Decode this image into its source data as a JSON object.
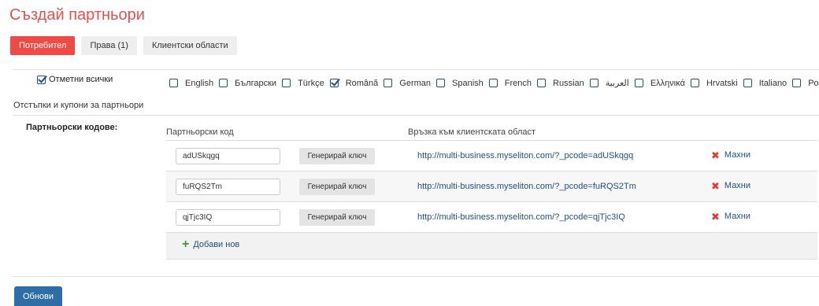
{
  "page": {
    "title": "Създай партньори"
  },
  "tabs": [
    {
      "label": "Потребител",
      "active": true
    },
    {
      "label": "Права (1)",
      "active": false
    },
    {
      "label": "Клиентски области",
      "active": false
    }
  ],
  "check_all": {
    "label": "Отметни всички",
    "checked": true
  },
  "languages": [
    {
      "label": "English",
      "checked": false
    },
    {
      "label": "Български",
      "checked": false
    },
    {
      "label": "Türkçe",
      "checked": false
    },
    {
      "label": "Română",
      "checked": true
    },
    {
      "label": "German",
      "checked": false
    },
    {
      "label": "Spanish",
      "checked": false
    },
    {
      "label": "French",
      "checked": false
    },
    {
      "label": "Russian",
      "checked": false
    },
    {
      "label": "العربية",
      "checked": false
    },
    {
      "label": "Ελληνικά",
      "checked": false
    },
    {
      "label": "Hrvatski",
      "checked": false
    },
    {
      "label": "Italiano",
      "checked": false
    },
    {
      "label": "Polski",
      "checked": false
    }
  ],
  "section": {
    "label": "Отстъпки и купони за партньори"
  },
  "codes": {
    "label": "Партньорски кодове:",
    "col_code": "Партньорски код",
    "col_link": "Връзка към клиентската област",
    "generate_label": "Генерирай ключ",
    "remove_label": "Махни",
    "add_label": "Добави нов",
    "rows": [
      {
        "code": "adUSkqgq",
        "link": "http://multi-business.myseliton.com/?_pcode=adUSkqgq"
      },
      {
        "code": "fuRQS2Tm",
        "link": "http://multi-business.myseliton.com/?_pcode=fuRQS2Tm"
      },
      {
        "code": "qjTjc3IQ",
        "link": "http://multi-business.myseliton.com/?_pcode=qjTjc3IQ"
      }
    ]
  },
  "actions": {
    "update_label": "Обнови"
  },
  "colors": {
    "accent_red": "#ef4a45",
    "link_blue": "#1f4e8f",
    "primary_button": "#2f6da6",
    "add_green": "#3a9b3f"
  }
}
